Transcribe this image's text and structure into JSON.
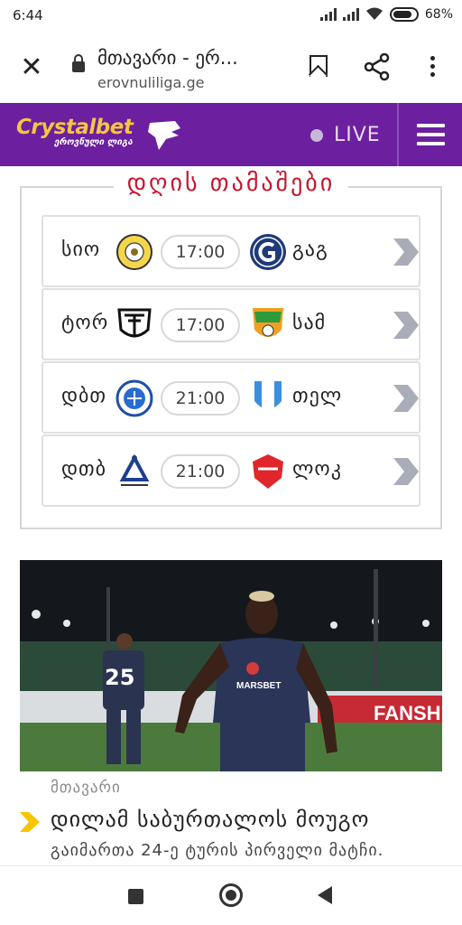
{
  "status_bar": {
    "time": "6:44",
    "battery": "68%"
  },
  "browser": {
    "title": "მთავარი - ერ...",
    "url": "erovnuliliga.ge"
  },
  "site_header": {
    "logo_name": "Crystalbet",
    "logo_sub": "ეროვნული ლიგა",
    "live_label": "LIVE",
    "accent_color": "#6c1f9e"
  },
  "games": {
    "title": "დღის თამაშები",
    "matches": [
      {
        "home": "სიო",
        "time": "17:00",
        "away": "გაგ"
      },
      {
        "home": "ტორ",
        "time": "17:00",
        "away": "სამ"
      },
      {
        "home": "დბთ",
        "time": "21:00",
        "away": "თელ"
      },
      {
        "home": "დთბ",
        "time": "21:00",
        "away": "ლოკ"
      }
    ]
  },
  "news": {
    "category": "მთავარი",
    "title": "დილამ საბურთალოს მოუგო",
    "subtitle": "გაიმართა 24-ე ტურის პირველი მატჩი.",
    "image_text": {
      "player_number": "25",
      "sponsor": "MARSBET",
      "board": "FANSH"
    }
  }
}
